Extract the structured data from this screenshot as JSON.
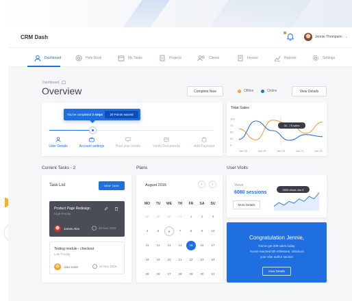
{
  "app": {
    "title": "CRM Dash"
  },
  "user": {
    "name": "Jennie Thompson"
  },
  "colors": {
    "primary": "#1f6fe0",
    "offline": "#ff9a3d",
    "online": "#1f6fe0",
    "dark_card": "#4a4d55"
  },
  "nav": {
    "items": [
      {
        "label": "Dashboard",
        "icon": "user-icon",
        "active": true
      },
      {
        "label": "Help Desk",
        "icon": "help-circle-icon"
      },
      {
        "label": "My Tasks",
        "icon": "calendar-icon"
      },
      {
        "label": "Projects",
        "icon": "document-icon"
      },
      {
        "label": "Clients",
        "icon": "users-icon"
      },
      {
        "label": "Invoice",
        "icon": "invoice-icon"
      },
      {
        "label": "Reports",
        "icon": "chart-icon"
      },
      {
        "label": "Settings",
        "icon": "gear-icon"
      }
    ]
  },
  "header": {
    "breadcrumb": "Dashboard",
    "title": "Overview",
    "complete_now": "Complete Now",
    "legend_offline": "Offline",
    "legend_online": "Online",
    "view_details": "View Details"
  },
  "steps": {
    "tooltip_prefix": "You've completed ",
    "tooltip_bold": "2 steps",
    "points_badge": "20 Points earned",
    "items": [
      {
        "label": "User Details",
        "done": true
      },
      {
        "label": "Account settings",
        "done": true
      },
      {
        "label": "Post your needs",
        "done": false
      },
      {
        "label": "Verify Documents",
        "done": false
      },
      {
        "label": "Add Payment",
        "done": false
      }
    ]
  },
  "total_sales": {
    "title": "Total Sales",
    "tooltip": "30 - 75 sales",
    "chart_data": {
      "type": "line",
      "title": "Total Sales",
      "categories": [
        "Jan 18",
        "Jan 19",
        "Jan 20",
        "Jan 21",
        "Jan 22"
      ],
      "yticks": [
        0,
        25,
        50,
        75,
        100
      ],
      "ylim": [
        0,
        110
      ],
      "series": [
        {
          "color": "#ff9a3d",
          "values": [
            62,
            20,
            95,
            82,
            45,
            88
          ]
        },
        {
          "color": "#1f6fe0",
          "values": [
            22,
            92,
            55,
            18,
            40,
            32
          ]
        }
      ]
    }
  },
  "current_tasks": {
    "heading": "Current Tasks - 2",
    "list_title": "Task List",
    "new_task": "NEW TASK",
    "tasks": [
      {
        "title": "Product Page Redesign",
        "priority": "High Priority",
        "person": "James Alex",
        "date": "30 Nov 2016"
      },
      {
        "title": "Testing module - checkout",
        "priority": "Low Priority",
        "person": "Alan smith",
        "date": "20 Nov 2016"
      }
    ]
  },
  "plans": {
    "heading": "Plans",
    "month": "August 2016",
    "weekdays": [
      "MO",
      "TU",
      "WE",
      "TH",
      "FR",
      "SA",
      "SU"
    ],
    "weeks": [
      [
        {
          "d": "28",
          "m": true
        },
        {
          "d": "29",
          "m": true
        },
        {
          "d": "30",
          "m": true
        },
        {
          "d": "31",
          "m": true
        },
        {
          "d": "1"
        },
        {
          "d": "2"
        },
        {
          "d": "3"
        }
      ],
      [
        {
          "d": "4"
        },
        {
          "d": "5"
        },
        {
          "d": "6",
          "ring": true
        },
        {
          "d": "7"
        },
        {
          "d": "8"
        },
        {
          "d": "9"
        },
        {
          "d": "10"
        }
      ],
      [
        {
          "d": "11"
        },
        {
          "d": "12"
        },
        {
          "d": "13"
        },
        {
          "d": "14"
        },
        {
          "d": "15",
          "sel": true
        },
        {
          "d": "16"
        },
        {
          "d": "17"
        }
      ],
      [
        {
          "d": "18"
        },
        {
          "d": "19"
        },
        {
          "d": "20"
        },
        {
          "d": "21"
        },
        {
          "d": "22"
        },
        {
          "d": "23"
        },
        {
          "d": "24"
        }
      ],
      [
        {
          "d": "25"
        },
        {
          "d": "26"
        },
        {
          "d": "27"
        },
        {
          "d": "28"
        },
        {
          "d": "29"
        },
        {
          "d": "30"
        },
        {
          "d": "31"
        }
      ]
    ]
  },
  "user_visits": {
    "heading": "User Visits",
    "views_label": "Views",
    "sessions": "6080 sessions",
    "more_details": "More Details",
    "tooltip": "4506 views  Jan 8",
    "chart_data": {
      "type": "area",
      "values": [
        22,
        28,
        24,
        30,
        27,
        34,
        30,
        38,
        34,
        44
      ]
    }
  },
  "congrats": {
    "title": "Congratulation Jennie,",
    "lines": [
      "You've got 208 sales today.",
      "You've reached 6th milestone, checkout",
      "your elite author section"
    ],
    "button": "View Details"
  }
}
